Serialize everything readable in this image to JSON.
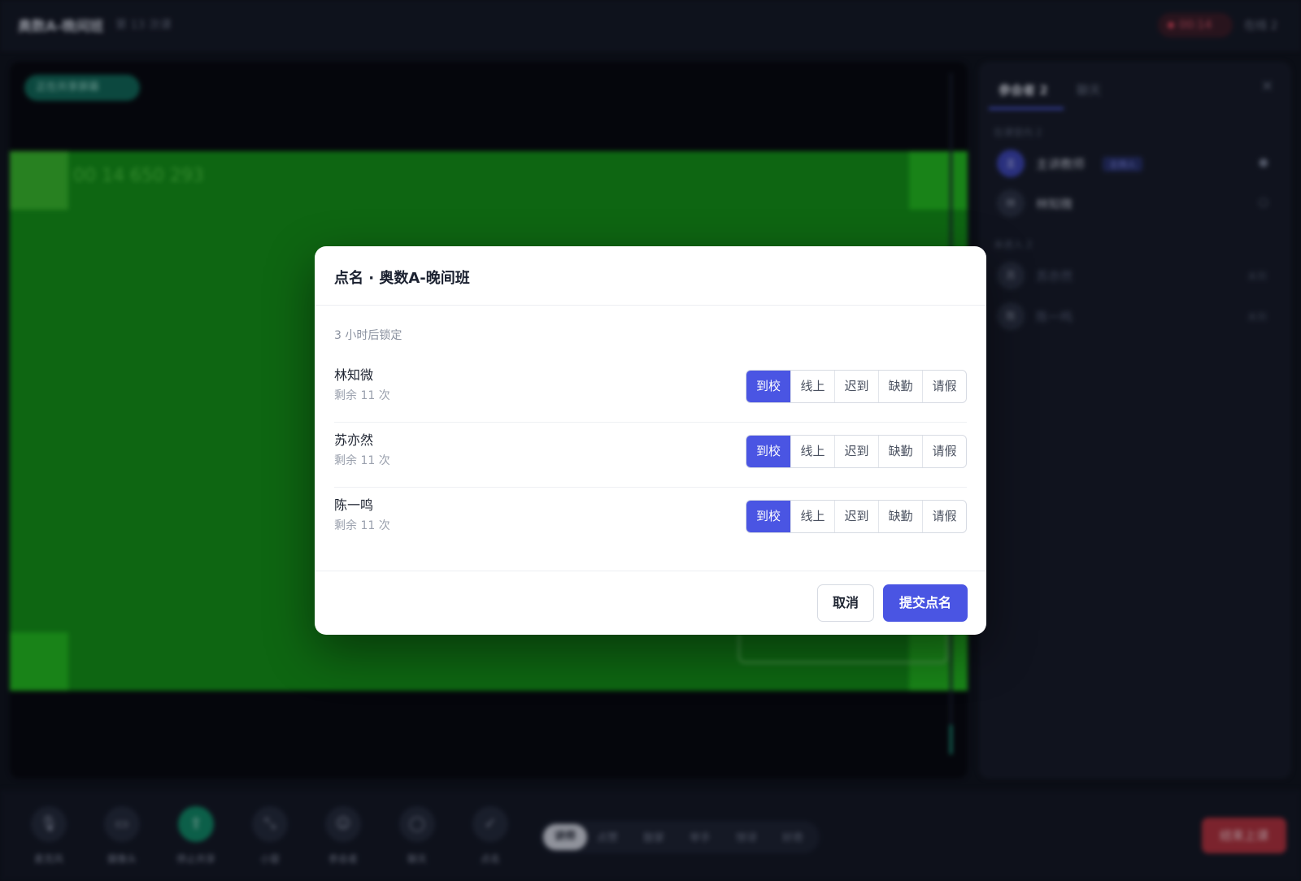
{
  "header": {
    "title": "奥数A-晚间班",
    "subtitle": "第 13 次课",
    "timer": "00:14",
    "online": "在线 2"
  },
  "stage": {
    "share_pill": "正在共享屏幕",
    "overlay_number": "00 14 650 293"
  },
  "side_panel": {
    "tab_participants": "参会者 2",
    "tab_chat": "聊天",
    "section_in_class": "在课堂内 2",
    "participants": [
      {
        "avatar": "主",
        "name": "主讲教师",
        "badge": "主持人"
      },
      {
        "avatar": "林",
        "name": "林知微"
      }
    ],
    "section_absent": "未进入 2",
    "absent": [
      {
        "avatar": "苏",
        "name": "苏亦然",
        "status": "未到"
      },
      {
        "avatar": "陈",
        "name": "陈一鸣",
        "status": "未到"
      }
    ]
  },
  "toolbar": {
    "buttons": [
      {
        "label": "麦克风",
        "icon": "mic-icon"
      },
      {
        "label": "摄像头",
        "icon": "camera-icon"
      },
      {
        "label": "停止共享",
        "icon": "share-icon"
      },
      {
        "label": "小窗",
        "icon": "minimize-icon"
      },
      {
        "label": "参会者",
        "icon": "people-icon"
      },
      {
        "label": "聊天",
        "icon": "chat-icon"
      },
      {
        "label": "点名",
        "icon": "check-icon"
      }
    ],
    "reactions": [
      "讲师",
      "点赞",
      "鼓掌",
      "举手",
      "惊讶",
      "好奇"
    ],
    "end_label": "结束上课"
  },
  "modal": {
    "title": "点名 · 奥数A-晚间班",
    "lock_note": "3 小时后锁定",
    "options": [
      "到校",
      "线上",
      "迟到",
      "缺勤",
      "请假"
    ],
    "students": [
      {
        "name": "林知微",
        "remaining": "剩余 11 次",
        "status": "到校"
      },
      {
        "name": "苏亦然",
        "remaining": "剩余 11 次",
        "status": "到校"
      },
      {
        "name": "陈一鸣",
        "remaining": "剩余 11 次",
        "status": "到校"
      }
    ],
    "cancel_label": "取消",
    "submit_label": "提交点名"
  },
  "colors": {
    "accent": "#4a55e3",
    "end_button": "#b8323c",
    "green_screen": "#119813"
  }
}
